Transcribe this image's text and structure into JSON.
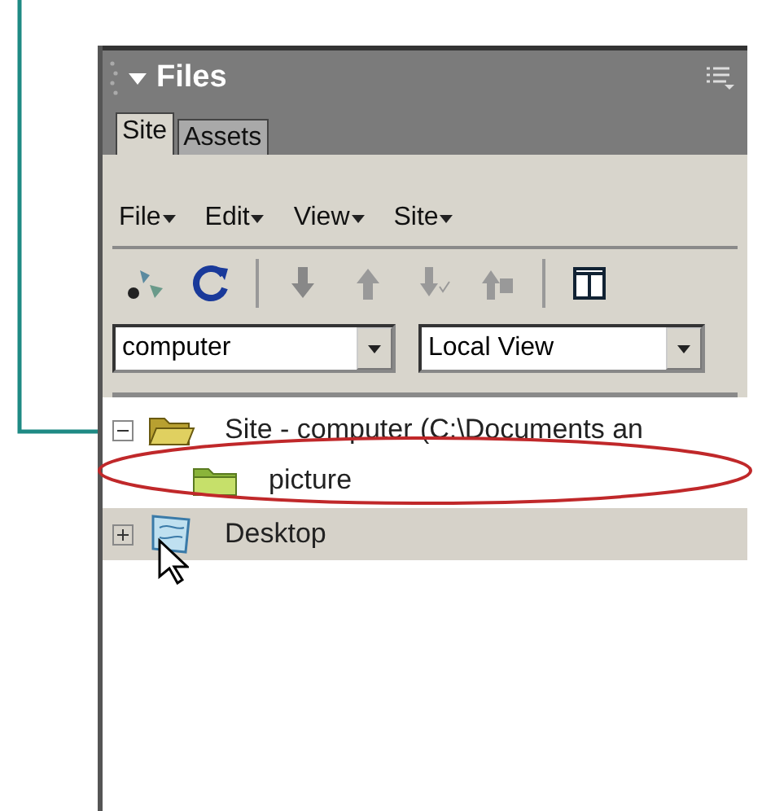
{
  "panel": {
    "title": "Files"
  },
  "tabs": [
    {
      "label": "Site",
      "selected": true
    },
    {
      "label": "Assets",
      "selected": false
    }
  ],
  "menus": [
    "File",
    "Edit",
    "View",
    "Site"
  ],
  "site_select": {
    "value": "computer"
  },
  "view_select": {
    "value": "Local View"
  },
  "tree": [
    {
      "label": "Site - computer (C:\\Documents an",
      "kind": "site",
      "expanded": true,
      "selected": false,
      "children": [
        {
          "label": "picture",
          "kind": "folder",
          "selected": false
        }
      ]
    },
    {
      "label": "Desktop",
      "kind": "desktop",
      "expanded": false,
      "selected": true
    }
  ]
}
